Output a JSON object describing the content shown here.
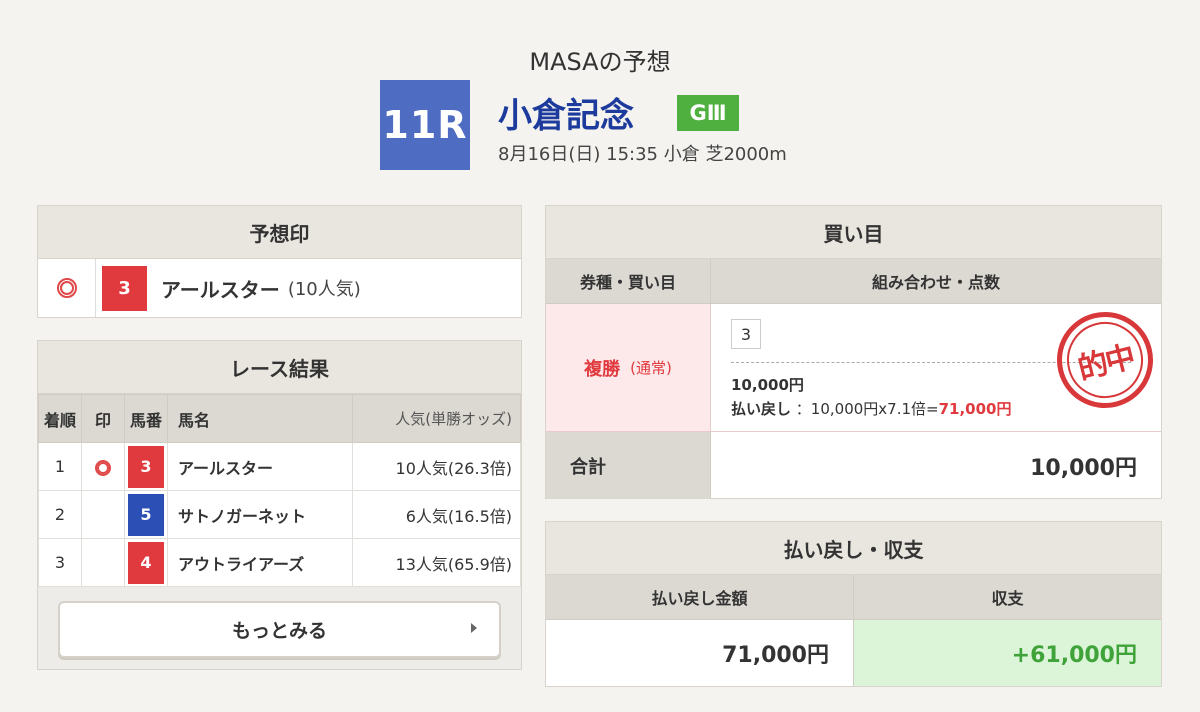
{
  "header": {
    "subtitle": "MASAの予想",
    "race_number": "11R",
    "race_name": "小倉記念",
    "grade": "GⅢ",
    "race_info": "8月16日(日) 15:35 小倉 芝2000m"
  },
  "colors": {
    "race_number_bg": "#4f6cc3",
    "race_name": "#1c3b9c",
    "grade_bg": "#4fb040",
    "horse_red": "#e0393e",
    "horse_blue": "#2c4fb5",
    "balance_green": "#3fa33a"
  },
  "prediction": {
    "title": "予想印",
    "mark_icon": "double-circle-icon",
    "horse_number": "3",
    "horse_name": "アールスター",
    "popularity": "(10人気)"
  },
  "results": {
    "title": "レース結果",
    "columns": [
      "着順",
      "印",
      "馬番",
      "馬名",
      "人気(単勝オッズ)"
    ],
    "rows": [
      {
        "rank": "1",
        "mark": "double-circle-icon",
        "number": "3",
        "number_color": "#e0393e",
        "name": "アールスター",
        "popularity": "10人気(26.3倍)"
      },
      {
        "rank": "2",
        "mark": "",
        "number": "5",
        "number_color": "#2c4fb5",
        "name": "サトノガーネット",
        "popularity": "6人気(16.5倍)"
      },
      {
        "rank": "3",
        "mark": "",
        "number": "4",
        "number_color": "#e0393e",
        "name": "アウトライアーズ",
        "popularity": "13人気(65.9倍)"
      }
    ],
    "more_label": "もっとみる"
  },
  "bets": {
    "title": "買い目",
    "col_type": "券種・買い目",
    "col_combo": "組み合わせ・点数",
    "bet_type": "複勝",
    "bet_subtype": "(通常)",
    "combo": "3",
    "amount": "10,000円",
    "payout_label": "払い戻し",
    "payout_formula": "：10,000円x7.1倍=",
    "payout_result": "71,000円",
    "stamp_text": "的中",
    "total_label": "合計",
    "total_value": "10,000円"
  },
  "payout": {
    "title": "払い戻し・収支",
    "col_amount": "払い戻し金額",
    "col_balance": "収支",
    "amount": "71,000円",
    "balance": "+61,000円"
  }
}
